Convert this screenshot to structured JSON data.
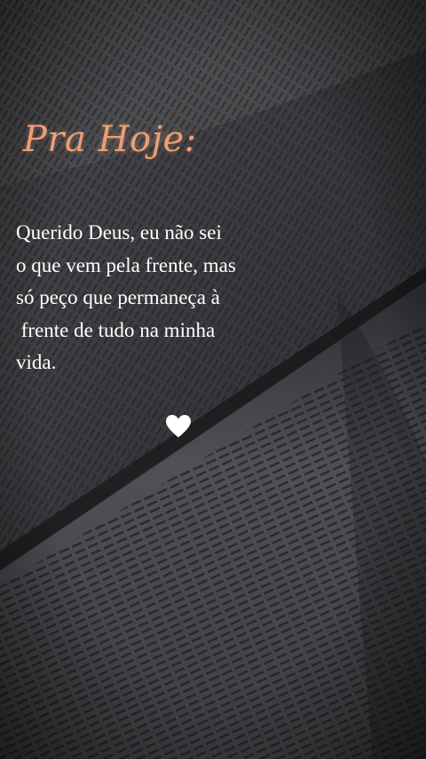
{
  "story": {
    "title": "Pra Hoje:",
    "message_lines": [
      "Querido Deus, eu não sei",
      "o que vem pela frente, mas",
      "só peço que permaneça à",
      " frente de tudo na minha",
      "vida."
    ],
    "heart_icon": "heart-icon",
    "colors": {
      "title": "#e9a076",
      "message": "#ffffff",
      "background": "#2a2a2e"
    }
  }
}
